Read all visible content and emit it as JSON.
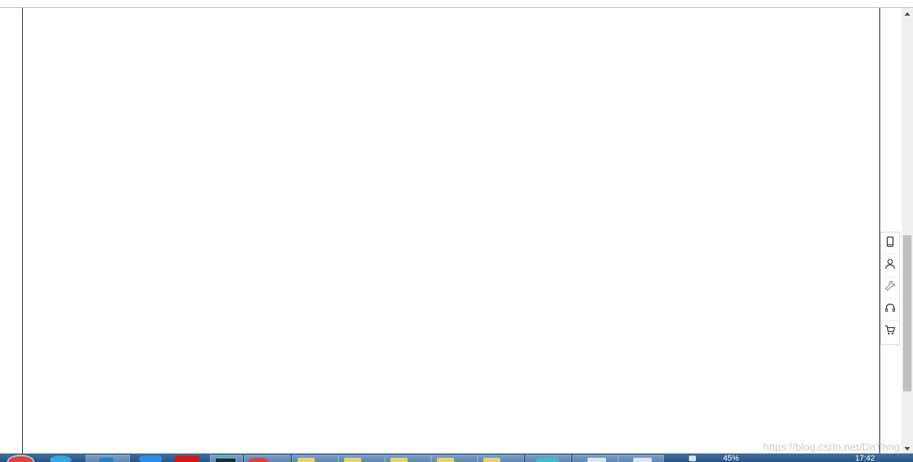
{
  "floating_toolbar": {
    "items": [
      {
        "icon": "mobile-icon"
      },
      {
        "icon": "user-icon"
      },
      {
        "icon": "wrench-icon"
      },
      {
        "icon": "headset-icon"
      },
      {
        "icon": "cart-icon"
      }
    ]
  },
  "watermark": "https://blog.csdn.net/DaThng",
  "taskbar": {
    "battery_percent": "45%",
    "clock": "17:42",
    "colors": {
      "taskbar": "#3a6698",
      "start_orb": "#d9463a",
      "ie": "#3aa6e0",
      "vscode": "#2a7fc0",
      "blue_app": "#2d8ce8",
      "red_app": "#d11a1a",
      "dark_app": "#1e2a33",
      "chrome": "#db4437",
      "folder": "#e8d079",
      "cyan_app": "#39c1c9",
      "notepad": "#dfe6ee"
    }
  }
}
